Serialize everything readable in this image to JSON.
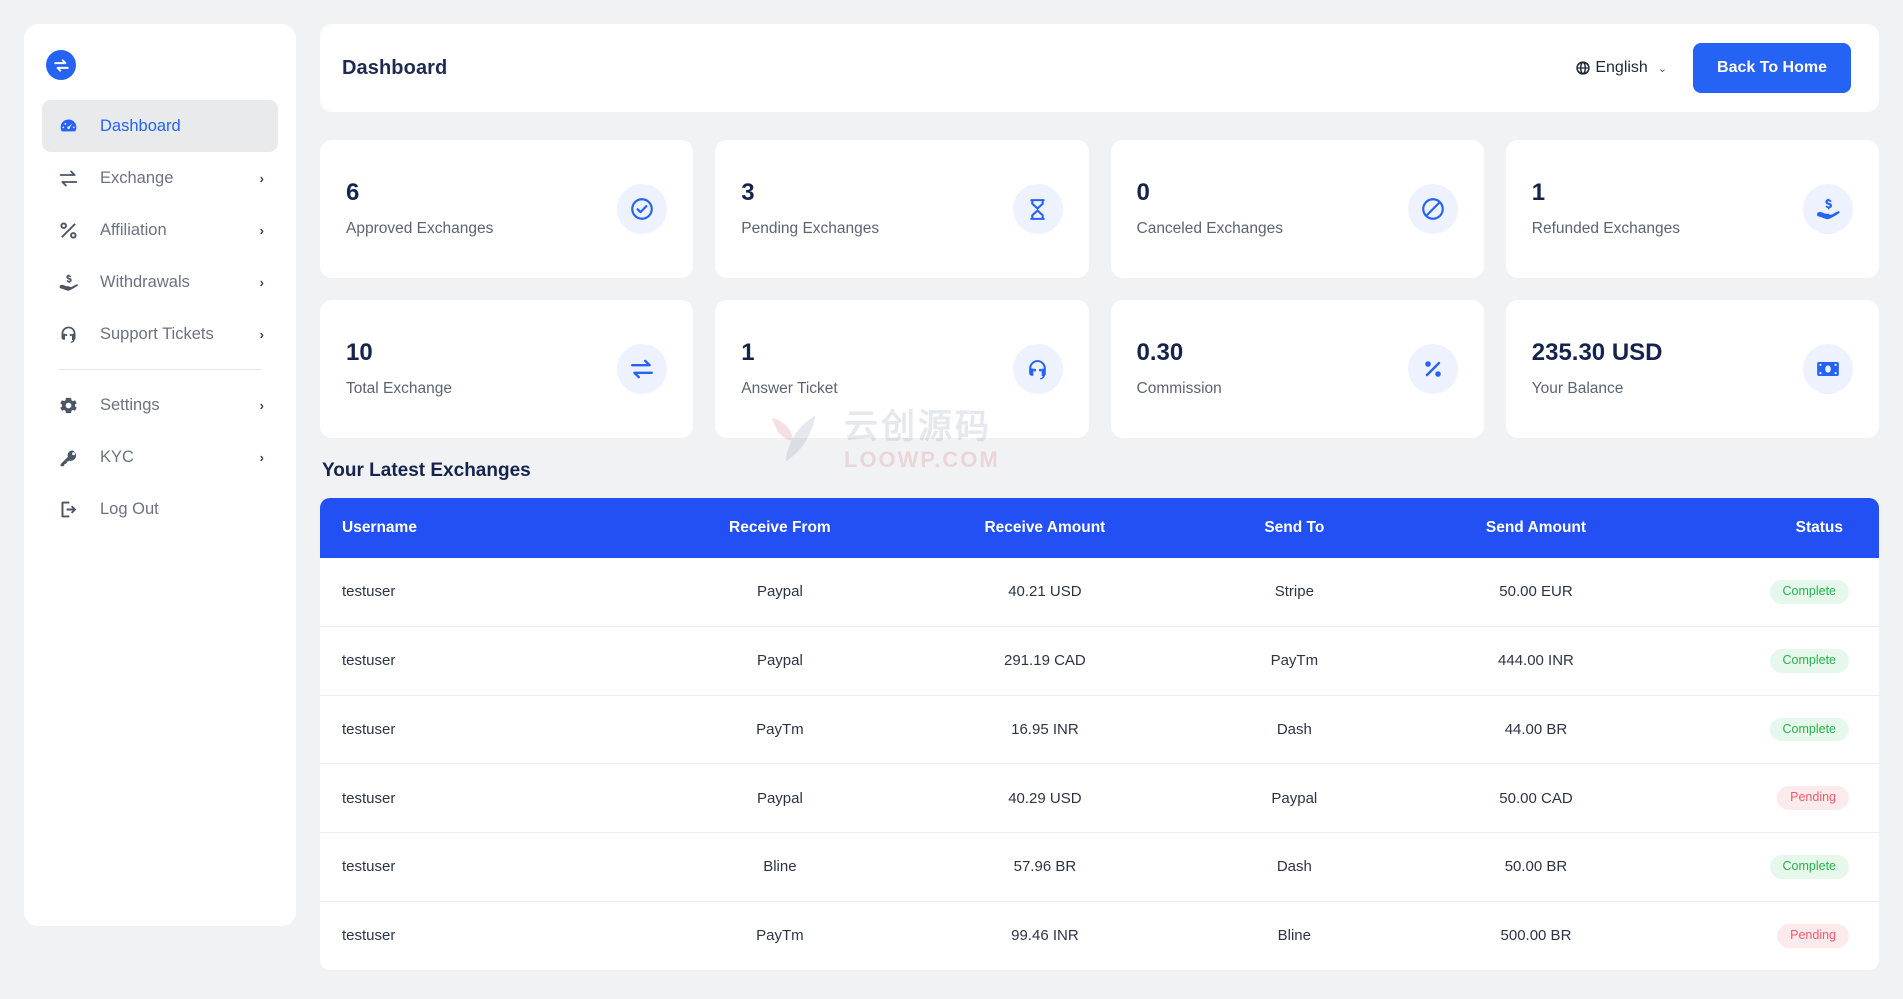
{
  "brand": {
    "logo_icon": "exchange-circle-icon"
  },
  "sidebar": {
    "items": [
      {
        "label": "Dashboard",
        "icon": "speedometer-icon",
        "active": true,
        "caret": ""
      },
      {
        "label": "Exchange",
        "icon": "exchange-arrows-icon",
        "active": false,
        "caret": "›"
      },
      {
        "label": "Affiliation",
        "icon": "percent-icon",
        "active": false,
        "caret": "›"
      },
      {
        "label": "Withdrawals",
        "icon": "hand-money-icon",
        "active": false,
        "caret": "›"
      },
      {
        "label": "Support Tickets",
        "icon": "headset-icon",
        "active": false,
        "caret": "›"
      },
      {
        "label": "Settings",
        "icon": "gear-icon",
        "active": false,
        "caret": "›"
      },
      {
        "label": "KYC",
        "icon": "key-icon",
        "active": false,
        "caret": "›"
      },
      {
        "label": "Log Out",
        "icon": "logout-icon",
        "active": false,
        "caret": ""
      }
    ]
  },
  "topbar": {
    "title": "Dashboard",
    "language": "English",
    "language_caret": "⌄",
    "back_home": "Back To Home"
  },
  "stats": [
    {
      "value": "6",
      "label": "Approved Exchanges",
      "icon": "check-circle-icon"
    },
    {
      "value": "3",
      "label": "Pending Exchanges",
      "icon": "hourglass-icon"
    },
    {
      "value": "0",
      "label": "Canceled Exchanges",
      "icon": "ban-icon"
    },
    {
      "value": "1",
      "label": "Refunded Exchanges",
      "icon": "hand-dollar-icon"
    },
    {
      "value": "10",
      "label": "Total Exchange",
      "icon": "exchange-arrows-icon"
    },
    {
      "value": "1",
      "label": "Answer Ticket",
      "icon": "headset-icon"
    },
    {
      "value": "0.30",
      "label": "Commission",
      "icon": "percent-icon"
    },
    {
      "value": "235.30 USD",
      "label": "Your Balance",
      "icon": "banknote-icon"
    }
  ],
  "table": {
    "title": "Your Latest Exchanges",
    "columns": [
      "Username",
      "Receive From",
      "Receive Amount",
      "Send To",
      "Send Amount",
      "Status"
    ],
    "rows": [
      {
        "username": "testuser",
        "receive_from": "Paypal",
        "receive_amount": "40.21 USD",
        "send_to": "Stripe",
        "send_amount": "50.00 EUR",
        "status": "Complete"
      },
      {
        "username": "testuser",
        "receive_from": "Paypal",
        "receive_amount": "291.19 CAD",
        "send_to": "PayTm",
        "send_amount": "444.00 INR",
        "status": "Complete"
      },
      {
        "username": "testuser",
        "receive_from": "PayTm",
        "receive_amount": "16.95 INR",
        "send_to": "Dash",
        "send_amount": "44.00 BR",
        "status": "Complete"
      },
      {
        "username": "testuser",
        "receive_from": "Paypal",
        "receive_amount": "40.29 USD",
        "send_to": "Paypal",
        "send_amount": "50.00 CAD",
        "status": "Pending"
      },
      {
        "username": "testuser",
        "receive_from": "Bline",
        "receive_amount": "57.96 BR",
        "send_to": "Dash",
        "send_amount": "50.00 BR",
        "status": "Complete"
      },
      {
        "username": "testuser",
        "receive_from": "PayTm",
        "receive_amount": "99.46 INR",
        "send_to": "Bline",
        "send_amount": "500.00 BR",
        "status": "Pending"
      }
    ]
  },
  "watermark": {
    "cn": "云创源码",
    "en": "LOOWP.COM"
  },
  "colors": {
    "accent": "#2563f5",
    "table_header": "#2250f4",
    "page_bg": "#f1f2f4",
    "title": "#16234d",
    "complete": "#24b24c",
    "pending": "#ef5a6a"
  }
}
